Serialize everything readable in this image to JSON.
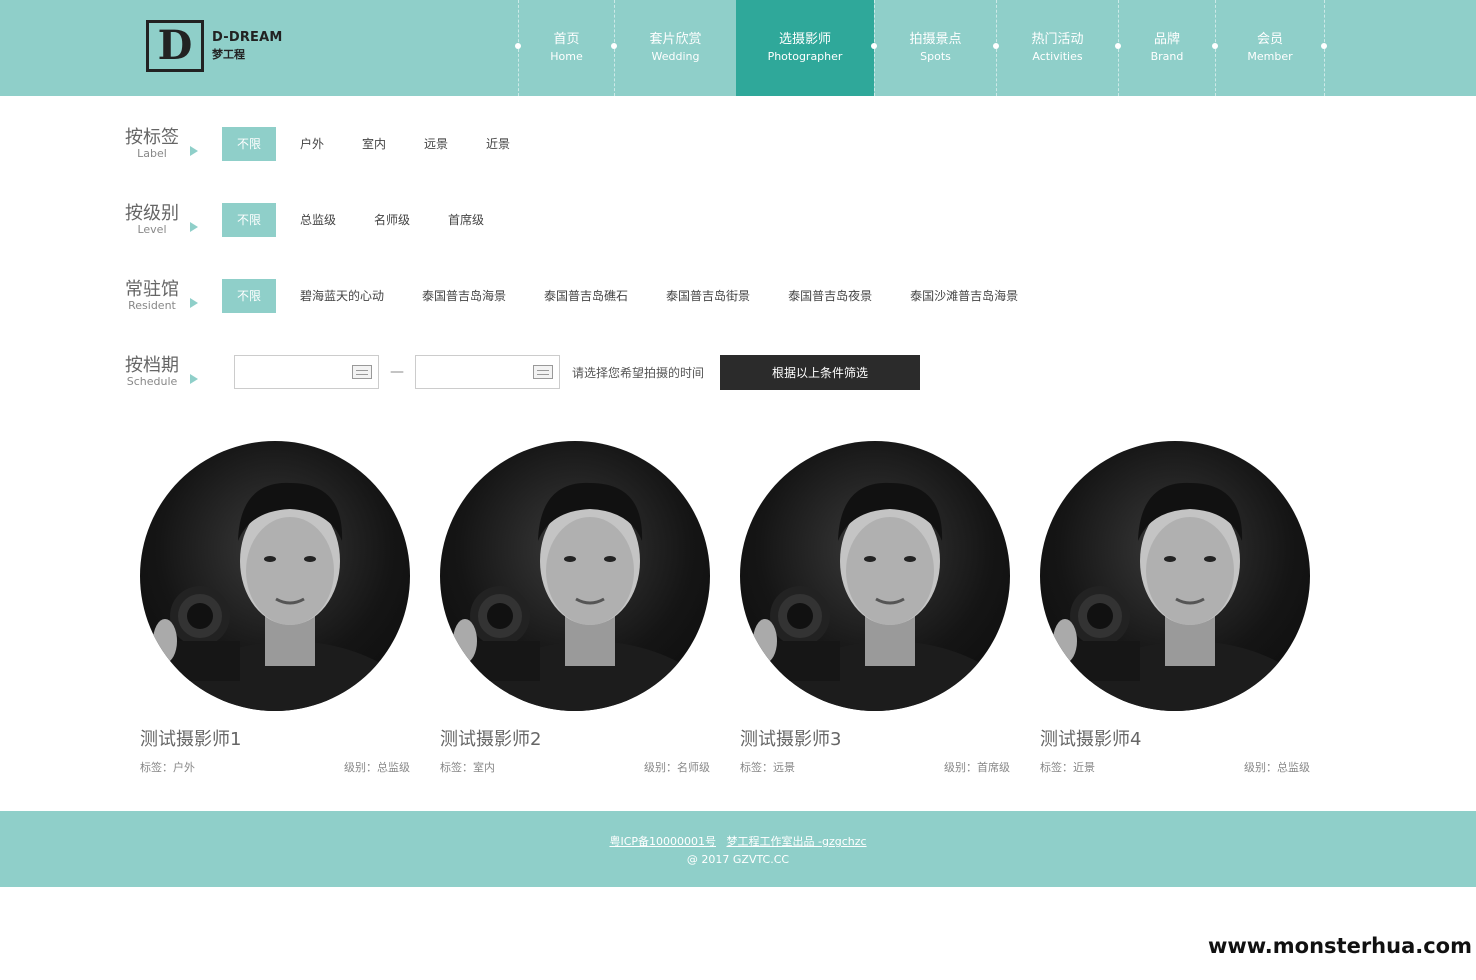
{
  "logo": {
    "en": "D-DREAM",
    "cn": "梦工程",
    "mark": "D"
  },
  "nav": [
    {
      "cn": "首页",
      "en": "Home",
      "active": false,
      "width": 96
    },
    {
      "cn": "套片欣赏",
      "en": "Wedding",
      "active": false,
      "width": 122
    },
    {
      "cn": "选摄影师",
      "en": "Photographer",
      "active": true,
      "width": 138
    },
    {
      "cn": "拍摄景点",
      "en": "Spots",
      "active": false,
      "width": 122
    },
    {
      "cn": "热门活动",
      "en": "Activities",
      "active": false,
      "width": 122
    },
    {
      "cn": "品牌",
      "en": "Brand",
      "active": false,
      "width": 97
    },
    {
      "cn": "会员",
      "en": "Member",
      "active": false,
      "width": 109
    }
  ],
  "filters": {
    "label": {
      "cn": "按标签",
      "en": "Label",
      "options": [
        "不限",
        "户外",
        "室内",
        "远景",
        "近景"
      ]
    },
    "level": {
      "cn": "按级别",
      "en": "Level",
      "options": [
        "不限",
        "总监级",
        "名师级",
        "首席级"
      ]
    },
    "resident": {
      "cn": "常驻馆",
      "en": "Resident",
      "options": [
        "不限",
        "碧海蓝天的心动",
        "泰国普吉岛海景",
        "泰国普吉岛礁石",
        "泰国普吉岛街景",
        "泰国普吉岛夜景",
        "泰国沙滩普吉岛海景"
      ]
    },
    "schedule": {
      "cn": "按档期",
      "en": "Schedule",
      "start_value": "",
      "end_value": "",
      "separator": "—",
      "hint": "请选择您希望拍摄的时间",
      "button": "根据以上条件筛选"
    }
  },
  "photographers": [
    {
      "name": "测试摄影师1",
      "tag_label": "标签：",
      "tag": "户外",
      "level_label": "级别：",
      "level": "总监级"
    },
    {
      "name": "测试摄影师2",
      "tag_label": "标签：",
      "tag": "室内",
      "level_label": "级别：",
      "level": "名师级"
    },
    {
      "name": "测试摄影师3",
      "tag_label": "标签：",
      "tag": "远景",
      "level_label": "级别：",
      "level": "首席级"
    },
    {
      "name": "测试摄影师4",
      "tag_label": "标签：",
      "tag": "近景",
      "level_label": "级别：",
      "level": "总监级"
    }
  ],
  "footer": {
    "icp": "粤ICP备10000001号",
    "studio": "梦工程工作室出品 -gzgchzc",
    "copyright": "@ 2017 GZVTC.CC"
  },
  "watermark": "www.monsterhua.com",
  "colors": {
    "brand": "#8fcfc9",
    "active": "#2fa89a",
    "button": "#2b2b2b"
  }
}
